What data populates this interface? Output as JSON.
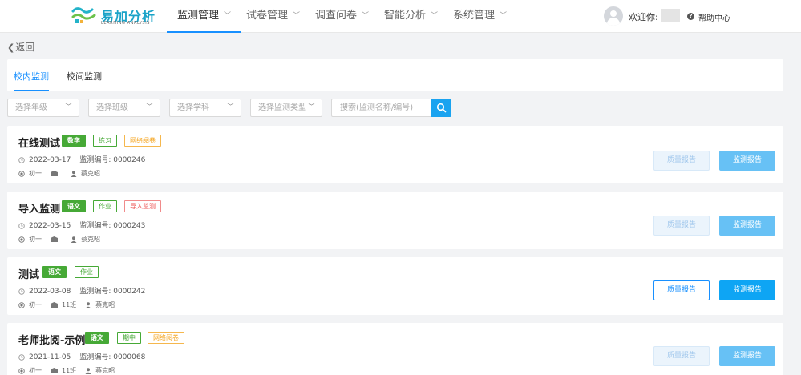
{
  "header": {
    "brand": "易加分析",
    "brand_sub": "LEARNING ANALYSIS",
    "nav": [
      {
        "label": "监测管理",
        "active": true
      },
      {
        "label": "试卷管理",
        "active": false
      },
      {
        "label": "调查问卷",
        "active": false
      },
      {
        "label": "智能分析",
        "active": false
      },
      {
        "label": "系统管理",
        "active": false
      }
    ],
    "welcome": "欢迎你:",
    "help": "帮助中心"
  },
  "back_label": "返回",
  "tabs": [
    {
      "label": "校内监测",
      "active": true
    },
    {
      "label": "校间监测",
      "active": false
    }
  ],
  "filters": [
    {
      "placeholder": "选择年级"
    },
    {
      "placeholder": "选择班级"
    },
    {
      "placeholder": "选择学科"
    },
    {
      "placeholder": "选择监测类型"
    }
  ],
  "search": {
    "placeholder": "搜索(监测名称/编号)"
  },
  "colors": {
    "accent": "#1890ff",
    "report": "#0ea5f4",
    "green": "#46a936",
    "orange": "#f5a623",
    "red": "#e55555"
  },
  "buttons": {
    "quality": "质量报告",
    "report": "监测报告"
  },
  "code_label": "监测编号:",
  "monitors": [
    {
      "title": "在线测试",
      "subject": "数学",
      "type": "练习",
      "extra": "网络阅卷",
      "extra_style": "orange",
      "date": "2022-03-17",
      "code": "0000246",
      "grade": "初一",
      "class": "",
      "teacher": "蔡克昭",
      "quality_enabled": false,
      "report_enabled": false
    },
    {
      "title": "导入监测",
      "subject": "语文",
      "type": "作业",
      "extra": "导入监测",
      "extra_style": "red",
      "date": "2022-03-15",
      "code": "0000243",
      "grade": "初一",
      "class": "",
      "teacher": "蔡克昭",
      "quality_enabled": false,
      "report_enabled": false
    },
    {
      "title": "测试",
      "subject": "语文",
      "type": "作业",
      "extra": "",
      "extra_style": "",
      "date": "2022-03-08",
      "code": "0000242",
      "grade": "初一",
      "class": "11班",
      "teacher": "蔡克昭",
      "quality_enabled": true,
      "report_enabled": true
    },
    {
      "title": "老师批阅-示例",
      "subject": "语文",
      "type": "期中",
      "extra": "网络阅卷",
      "extra_style": "orange",
      "date": "2021-11-05",
      "code": "0000068",
      "grade": "初一",
      "class": "11班",
      "teacher": "蔡克昭",
      "quality_enabled": false,
      "report_enabled": false
    }
  ]
}
